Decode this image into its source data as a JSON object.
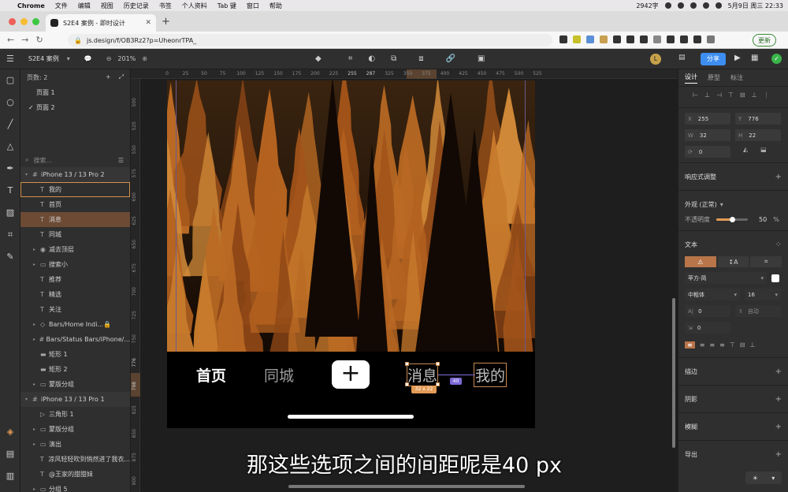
{
  "menubar": {
    "items": [
      "Chrome",
      "文件",
      "编辑",
      "视图",
      "历史记录",
      "书签",
      "个人资料",
      "Tab 键",
      "窗口",
      "帮助"
    ],
    "word_count": "2942字",
    "datetime": "5月9日 周三 22:33"
  },
  "browser": {
    "tab_title": "S2E4 案例 - 即时设计",
    "url": "js.design/f/OB3Rz2?p=UheonrTPA_",
    "update_label": "更新"
  },
  "toolbar": {
    "project": "S2E4 案例",
    "zoom": "201%",
    "avatar_letter": "L",
    "share_label": "分享"
  },
  "layers": {
    "pages_label": "页数: 2",
    "pages": [
      "页面 1",
      "页面 2"
    ],
    "search_placeholder": "搜索...",
    "items": [
      {
        "label": "iPhone 13 / 13 Pro 2",
        "icon": "#",
        "depth": 0,
        "arrow": "▾",
        "state": "frame"
      },
      {
        "label": "我的",
        "icon": "T",
        "depth": 1,
        "arrow": "",
        "state": "sel-outline"
      },
      {
        "label": "首页",
        "icon": "T",
        "depth": 1,
        "arrow": "",
        "state": ""
      },
      {
        "label": "消息",
        "icon": "T",
        "depth": 1,
        "arrow": "",
        "state": "sel-fill"
      },
      {
        "label": "同城",
        "icon": "T",
        "depth": 1,
        "arrow": "",
        "state": ""
      },
      {
        "label": "减去顶层",
        "icon": "◉",
        "depth": 1,
        "arrow": "▸",
        "state": ""
      },
      {
        "label": "搜索小",
        "icon": "▭",
        "depth": 1,
        "arrow": "▸",
        "state": ""
      },
      {
        "label": "推荐",
        "icon": "T",
        "depth": 1,
        "arrow": "",
        "state": ""
      },
      {
        "label": "精选",
        "icon": "T",
        "depth": 1,
        "arrow": "",
        "state": ""
      },
      {
        "label": "关注",
        "icon": "T",
        "depth": 1,
        "arrow": "",
        "state": ""
      },
      {
        "label": "Bars/Home Indi...",
        "icon": "◇",
        "depth": 1,
        "arrow": "▸",
        "state": "",
        "locked": true
      },
      {
        "label": "Bars/Status Bars/iPhone/...",
        "icon": "#",
        "depth": 1,
        "arrow": "▸",
        "state": ""
      },
      {
        "label": "矩形 1",
        "icon": "▬",
        "depth": 1,
        "arrow": "",
        "state": ""
      },
      {
        "label": "矩形 2",
        "icon": "▬",
        "depth": 1,
        "arrow": "",
        "state": ""
      },
      {
        "label": "蒙版分组",
        "icon": "▭",
        "depth": 1,
        "arrow": "▸",
        "state": ""
      },
      {
        "label": "iPhone 13 / 13 Pro 1",
        "icon": "#",
        "depth": 0,
        "arrow": "▾",
        "state": "frame"
      },
      {
        "label": "三角形 1",
        "icon": "▷",
        "depth": 1,
        "arrow": "",
        "state": ""
      },
      {
        "label": "蒙版分组",
        "icon": "▭",
        "depth": 1,
        "arrow": "▸",
        "state": ""
      },
      {
        "label": "演出",
        "icon": "▭",
        "depth": 1,
        "arrow": "▸",
        "state": ""
      },
      {
        "label": "凉风轻轻吹到悄然进了我衣...",
        "icon": "T",
        "depth": 1,
        "arrow": "",
        "state": ""
      },
      {
        "label": "@王家的甜甜妹",
        "icon": "T",
        "depth": 1,
        "arrow": "",
        "state": ""
      },
      {
        "label": "分组 5",
        "icon": "▭",
        "depth": 1,
        "arrow": "▸",
        "state": ""
      }
    ]
  },
  "canvas": {
    "ruler_top": [
      "0",
      "25",
      "50",
      "75",
      "100",
      "125",
      "150",
      "175",
      "200",
      "225",
      "255",
      "287",
      "325",
      "350",
      "375",
      "400",
      "425",
      "450",
      "475",
      "500",
      "525"
    ],
    "ruler_left": [
      "500",
      "525",
      "550",
      "575",
      "600",
      "625",
      "650",
      "675",
      "700",
      "725",
      "750",
      "776",
      "798",
      "825",
      "850",
      "875",
      "900"
    ],
    "nav": {
      "home": "首页",
      "city": "同城",
      "plus": "+",
      "message": "消息",
      "mine": "我的"
    },
    "selection_size": "32 x 22",
    "distance": "40",
    "subtitle": "那这些选项之间的间距呢是40 px"
  },
  "props": {
    "tabs": [
      "设计",
      "原型",
      "标注"
    ],
    "x": "255",
    "y": "776",
    "w": "32",
    "h": "22",
    "rotation": "0",
    "responsive_label": "响应式调整",
    "appearance_label": "外观 (正常)",
    "opacity_label": "不透明度",
    "opacity_value": "50",
    "opacity_unit": "%",
    "opacity_fraction": 0.5,
    "text_label": "文本",
    "font_family": "苹方-简",
    "font_weight": "中粗体",
    "font_size": "16",
    "letter_spacing": "0",
    "line_height": "自动",
    "paragraph_spacing": "0",
    "stroke_label": "描边",
    "shadow_label": "阴影",
    "blur_label": "模糊",
    "export_label": "导出"
  }
}
